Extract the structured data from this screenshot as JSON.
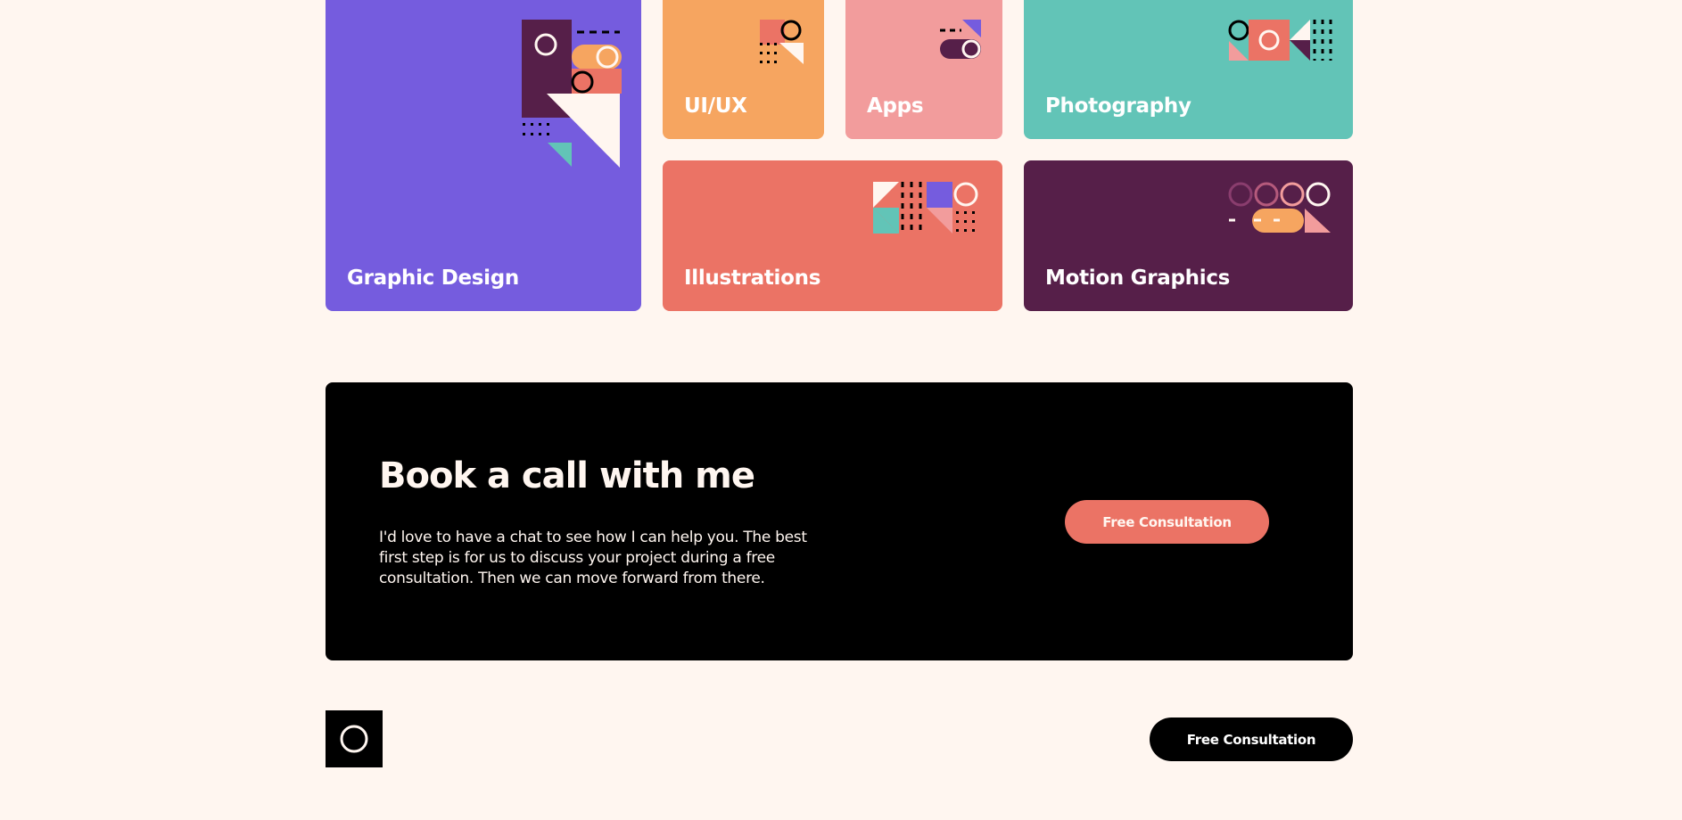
{
  "colors": {
    "background": "#FFF6F0",
    "purple": "#755CDE",
    "orange": "#F6A560",
    "pink": "#F29C9C",
    "teal": "#62C4B7",
    "coral": "#EB7365",
    "plum": "#561F49",
    "black": "#000000"
  },
  "services": {
    "graphic_design": "Graphic Design",
    "uiux": "UI/UX",
    "apps": "Apps",
    "photography": "Photography",
    "illustrations": "Illustrations",
    "motion_graphics": "Motion Graphics"
  },
  "cta": {
    "title": "Book a call with me",
    "description": "I'd love to have a chat to see how I can help you. The best first step is for us to discuss your project during a free consultation. Then we can move forward from there.",
    "button_label": "Free Consultation"
  },
  "footer": {
    "logo_icon": "ring-logo-icon",
    "button_label": "Free Consultation"
  }
}
